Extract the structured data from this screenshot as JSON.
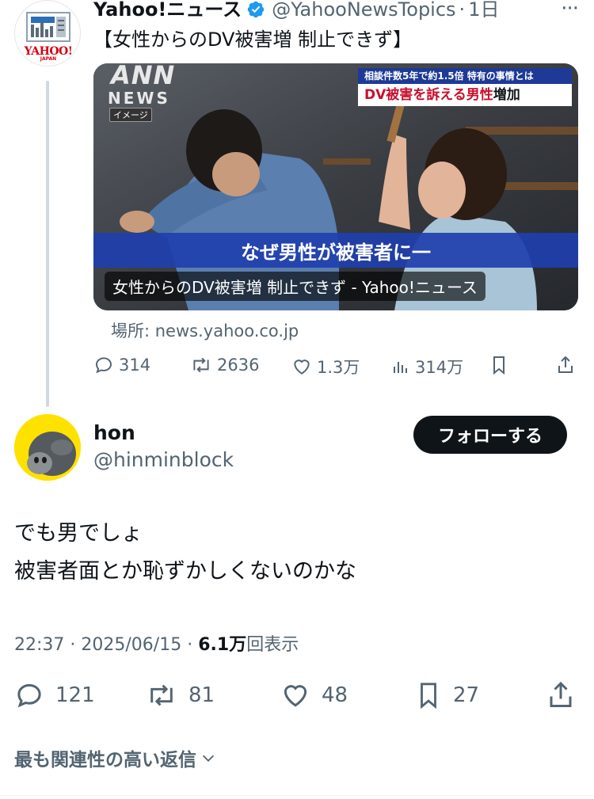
{
  "quoted_tweet": {
    "display_name": "Yahoo!ニュース",
    "handle": "@YahooNewsTopics",
    "separator": "·",
    "time": "1日",
    "more": "···",
    "avatar_logo_text": "YAHOO!",
    "avatar_logo_sub": "JAPAN",
    "text": "【女性からのDV被害増 制止できず】",
    "card": {
      "caption": "女性からのDV被害増 制止できず - Yahoo!ニュース",
      "ann_label": "ANN",
      "news_label": "NEWS",
      "image_tag": "イメージ",
      "headline_top": "相談件数5年で約1.5倍  特有の事情とは",
      "headline_main": "DV被害を訴える男性",
      "headline_accent": "増加",
      "subtitle": "なぜ男性が被害者に一"
    },
    "location": "場所: news.yahoo.co.jp",
    "stats": {
      "replies": "314",
      "retweets": "2636",
      "likes": "1.3万",
      "views": "314万"
    }
  },
  "main_tweet": {
    "display_name": "hon",
    "handle": "@hinminblock",
    "follow_label": "フォローする",
    "text_lines": [
      "でも男でしょ",
      "被害者面とか恥ずかしくないのかな"
    ],
    "time": "22:37",
    "dot": "·",
    "date": "2025/06/15",
    "dot2": "·",
    "views_count": "6.1万",
    "views_label": "回表示",
    "stats": {
      "replies": "121",
      "retweets": "81",
      "likes": "48",
      "bookmarks": "27"
    }
  },
  "replies_sort_label": "最も関連性の高い返信",
  "colors": {
    "text": "#0f1419",
    "muted": "#536471",
    "verified": "#1d9bf0",
    "thread_line": "#cfd9de",
    "card_blue": "#1f3fae",
    "news_red": "#c8102e"
  }
}
